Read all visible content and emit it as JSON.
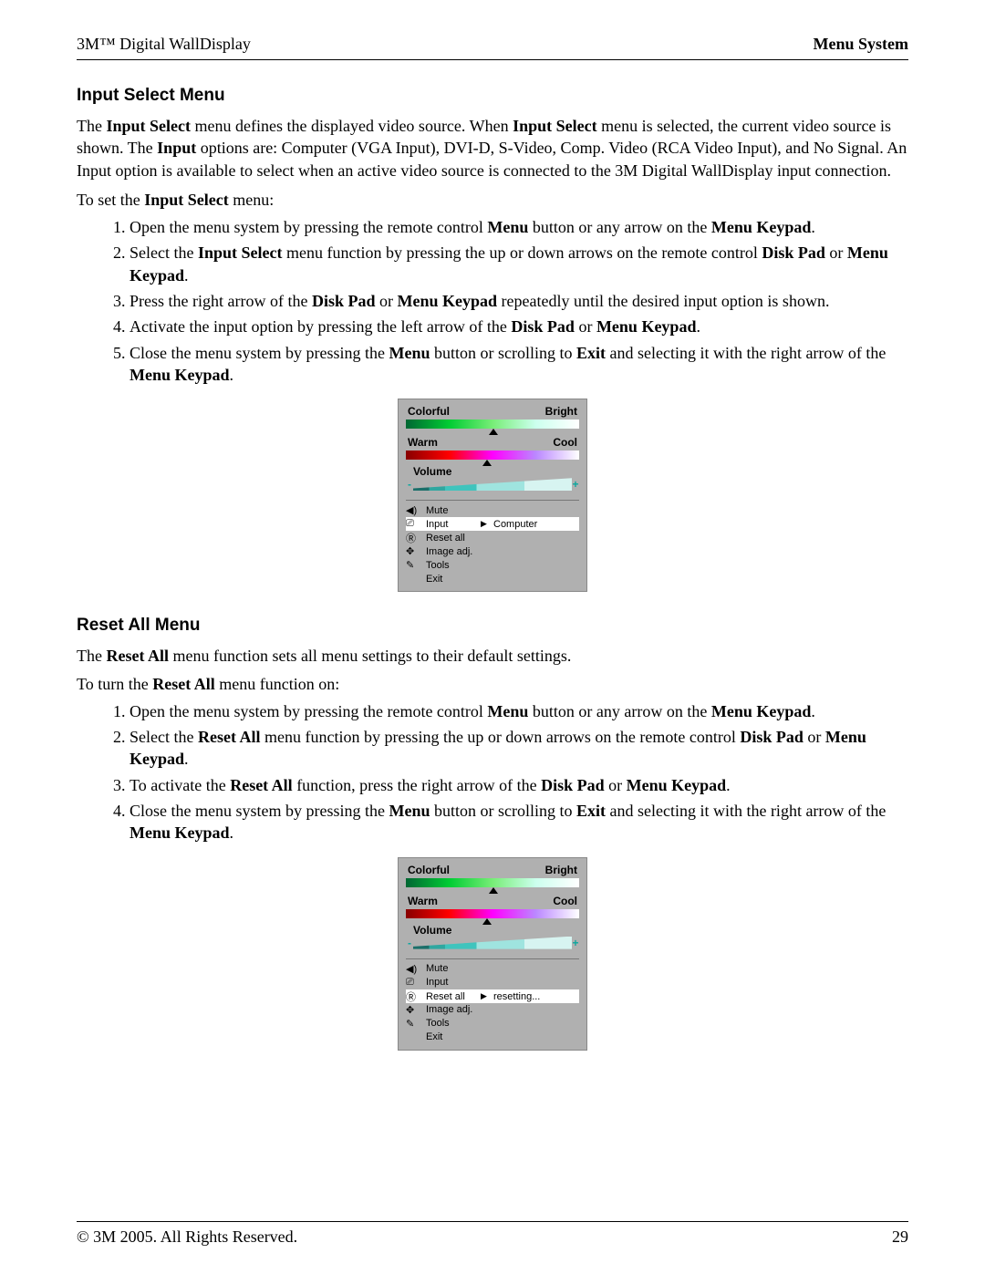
{
  "header": {
    "left": "3M™ Digital WallDisplay",
    "right": "Menu System"
  },
  "footer": {
    "left": "© 3M 2005. All Rights Reserved.",
    "right": "29"
  },
  "section1": {
    "title": "Input Select Menu",
    "para1a": "The ",
    "para1b": "Input Select",
    "para1c": " menu defines the displayed video source. When ",
    "para1d": "Input Select",
    "para1e": " menu is selected, the current video source is shown. The ",
    "para1f": "Input",
    "para1g": " options are:  Computer (VGA Input), DVI-D, S-Video, Comp. Video (RCA Video Input), and No Signal. An Input option is available to select when an active video source is connected to the 3M Digital WallDisplay input connection.",
    "para2a": "To set the ",
    "para2b": "Input Select",
    "para2c": " menu:",
    "steps": {
      "s1a": "Open the menu system by pressing the remote control ",
      "s1b": "Menu",
      "s1c": " button or any arrow on the ",
      "s1d": "Menu Keypad",
      "s1e": ".",
      "s2a": "Select the ",
      "s2b": "Input Select",
      "s2c": " menu function by pressing the up or down arrows on the remote control ",
      "s2d": "Disk Pad",
      "s2e": " or ",
      "s2f": "Menu Keypad",
      "s2g": ".",
      "s3a": "Press the right arrow of the ",
      "s3b": "Disk Pad",
      "s3c": " or ",
      "s3d": "Menu Keypad",
      "s3e": " repeatedly until the desired input option is shown.",
      "s4a": "Activate the input option by pressing the left arrow of the ",
      "s4b": "Disk Pad",
      "s4c": " or ",
      "s4d": "Menu Keypad",
      "s4e": ".",
      "s5a": "Close the menu system by pressing the ",
      "s5b": "Menu",
      "s5c": " button or scrolling to ",
      "s5d": "Exit",
      "s5e": " and selecting it with the right arrow of the ",
      "s5f": "Menu Keypad",
      "s5g": "."
    }
  },
  "osd": {
    "colorful": "Colorful",
    "bright": "Bright",
    "warm": "Warm",
    "cool": "Cool",
    "volume": "Volume",
    "minus": "-",
    "plus": "+",
    "items": {
      "mute": "Mute",
      "input": "Input",
      "resetall": "Reset all",
      "imageadj": "Image adj.",
      "tools": "Tools",
      "exit": "Exit"
    },
    "input_value": "Computer",
    "reset_value": "resetting...",
    "arrow": "▶"
  },
  "section2": {
    "title": "Reset All Menu",
    "para1a": "The ",
    "para1b": "Reset All",
    "para1c": " menu function sets all menu settings to their default settings.",
    "para2a": "To turn the ",
    "para2b": "Reset All",
    "para2c": " menu function on:",
    "steps": {
      "s1a": "Open the menu system by pressing the remote control ",
      "s1b": "Menu",
      "s1c": " button or any arrow on the ",
      "s1d": "Menu Keypad",
      "s1e": ".",
      "s2a": "Select the ",
      "s2b": "Reset All",
      "s2c": " menu function by pressing the up or down arrows on the remote control ",
      "s2d": "Disk Pad",
      "s2e": " or ",
      "s2f": "Menu Keypad",
      "s2g": ".",
      "s3a": "To activate the ",
      "s3b": "Reset All",
      "s3c": " function, press the right arrow of the ",
      "s3d": "Disk Pad",
      "s3e": " or ",
      "s3f": "Menu Keypad",
      "s3g": ".",
      "s4a": "Close the menu system by pressing the ",
      "s4b": "Menu",
      "s4c": " button or scrolling to ",
      "s4d": "Exit",
      "s4e": " and selecting it with the right arrow of the ",
      "s4f": "Menu Keypad",
      "s4g": "."
    }
  }
}
